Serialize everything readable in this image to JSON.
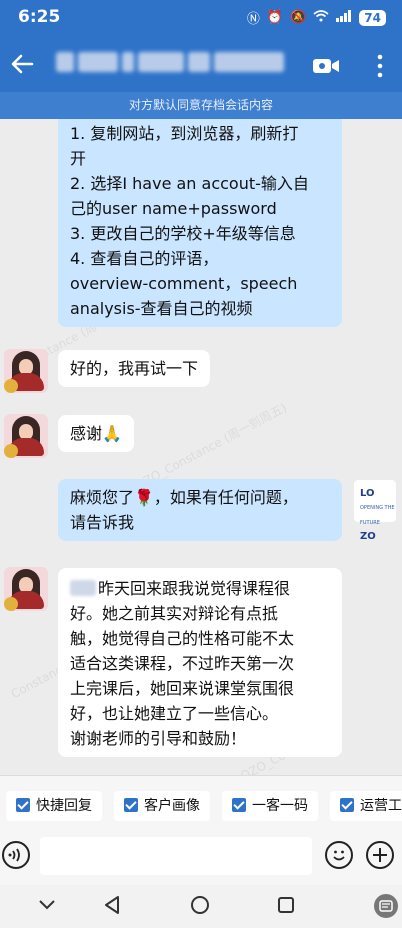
{
  "status": {
    "time": "6:25",
    "battery": "74"
  },
  "header": {
    "notice": "对方默认同意存档会话内容"
  },
  "messages": [
    {
      "from": "me",
      "lines": [
        "1. 复制网站，到浏览器，刷新打",
        "开",
        "2. 选择I have an accout-输入自",
        "己的user name+password",
        "3. 更改自己的学校+年级等信息",
        "4. 查看自己的评语，",
        "overview-comment，speech",
        "analysis-查看自己的视频"
      ]
    },
    {
      "from": "them",
      "text": "好的，我再试一下"
    },
    {
      "from": "them",
      "text": "感谢🙏"
    },
    {
      "from": "me",
      "lines": [
        "麻烦您了🌹，如果有任何问题，",
        "请告诉我"
      ]
    },
    {
      "from": "them",
      "lines": [
        "昨天回来跟我说觉得课程很",
        "好。她之前其实对辩论有点抵",
        "触，她觉得自己的性格可能不太",
        "适合这类课程，不过昨天第一次",
        "上完课后，她回来说课堂氛围很",
        "好，也让她建立了一些信心。",
        "谢谢老师的引导和鼓励！"
      ]
    }
  ],
  "logo": {
    "text1": "LO",
    "text2": "ZO",
    "small": "OPENING THE FUTURE"
  },
  "watermarks": [
    "Constance (周一到周五)LOZO0056",
    "LOZO_Constance (周一到周五)",
    "Constance (周一到周五)LOZO0056",
    "LOZO_Constance"
  ],
  "quick_tabs": [
    "快捷回复",
    "客户画像",
    "一客一码",
    "运营工"
  ]
}
